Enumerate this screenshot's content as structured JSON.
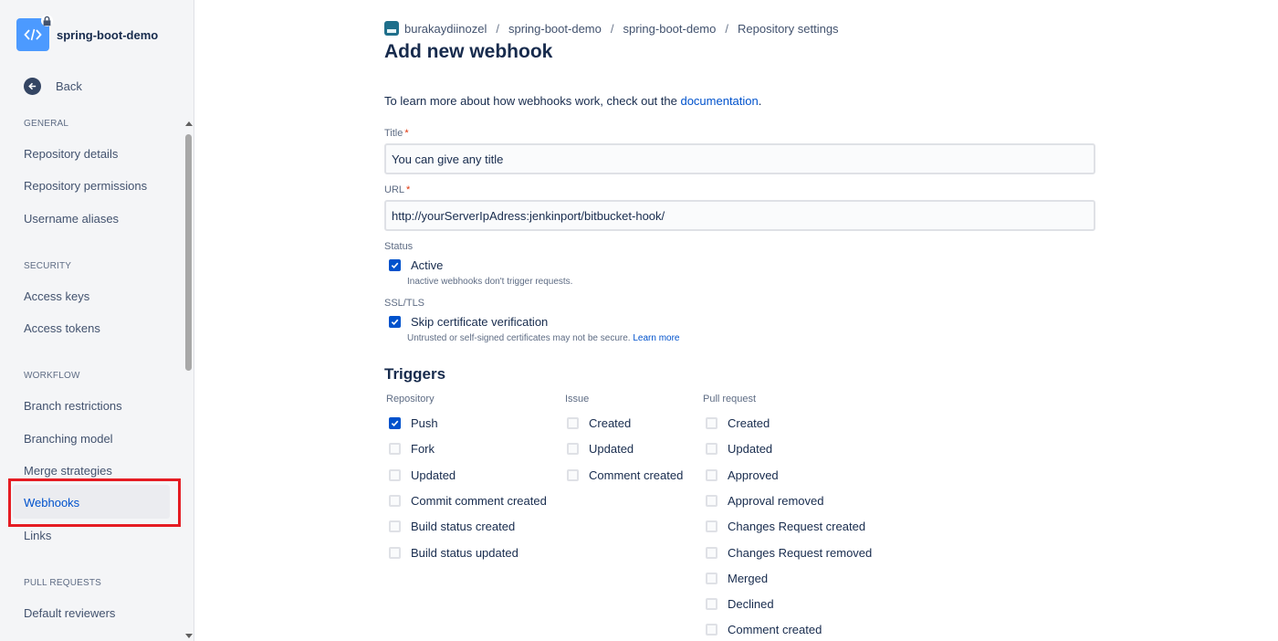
{
  "sidebar": {
    "repo_name": "spring-boot-demo",
    "back_label": "Back",
    "sections": {
      "general": "GENERAL",
      "security": "SECURITY",
      "workflow": "WORKFLOW",
      "pull_requests": "PULL REQUESTS"
    },
    "items": {
      "repository_details": "Repository details",
      "repository_permissions": "Repository permissions",
      "username_aliases": "Username aliases",
      "access_keys": "Access keys",
      "access_tokens": "Access tokens",
      "branch_restrictions": "Branch restrictions",
      "branching_model": "Branching model",
      "merge_strategies": "Merge strategies",
      "webhooks": "Webhooks",
      "links": "Links",
      "default_reviewers": "Default reviewers"
    }
  },
  "breadcrumb": [
    "burakaydiinozel",
    "spring-boot-demo",
    "spring-boot-demo",
    "Repository settings"
  ],
  "page": {
    "title": "Add new webhook",
    "intro_text": "To learn more about how webhooks work, check out the ",
    "intro_link": "documentation",
    "intro_end": "."
  },
  "form": {
    "title_label": "Title",
    "title_value": "You can give any title",
    "url_label": "URL",
    "url_value": "http://yourServerIpAdress:jenkinport/bitbucket-hook/",
    "status_label": "Status",
    "active_label": "Active",
    "active_checked": true,
    "active_help": "Inactive webhooks don't trigger requests.",
    "ssl_label": "SSL/TLS",
    "skip_cert_label": "Skip certificate verification",
    "skip_cert_checked": true,
    "skip_cert_help": "Untrusted or self-signed certificates may not be secure.",
    "learn_more": "Learn more"
  },
  "triggers": {
    "title": "Triggers",
    "repository": {
      "heading": "Repository",
      "items": [
        {
          "label": "Push",
          "checked": true
        },
        {
          "label": "Fork",
          "checked": false
        },
        {
          "label": "Updated",
          "checked": false
        },
        {
          "label": "Commit comment created",
          "checked": false
        },
        {
          "label": "Build status created",
          "checked": false
        },
        {
          "label": "Build status updated",
          "checked": false
        }
      ]
    },
    "issue": {
      "heading": "Issue",
      "items": [
        {
          "label": "Created",
          "checked": false
        },
        {
          "label": "Updated",
          "checked": false
        },
        {
          "label": "Comment created",
          "checked": false
        }
      ]
    },
    "pull_request": {
      "heading": "Pull request",
      "items": [
        {
          "label": "Created",
          "checked": false
        },
        {
          "label": "Updated",
          "checked": false
        },
        {
          "label": "Approved",
          "checked": false
        },
        {
          "label": "Approval removed",
          "checked": false
        },
        {
          "label": "Changes Request created",
          "checked": false
        },
        {
          "label": "Changes Request removed",
          "checked": false
        },
        {
          "label": "Merged",
          "checked": false
        },
        {
          "label": "Declined",
          "checked": false
        },
        {
          "label": "Comment created",
          "checked": false
        }
      ]
    }
  }
}
